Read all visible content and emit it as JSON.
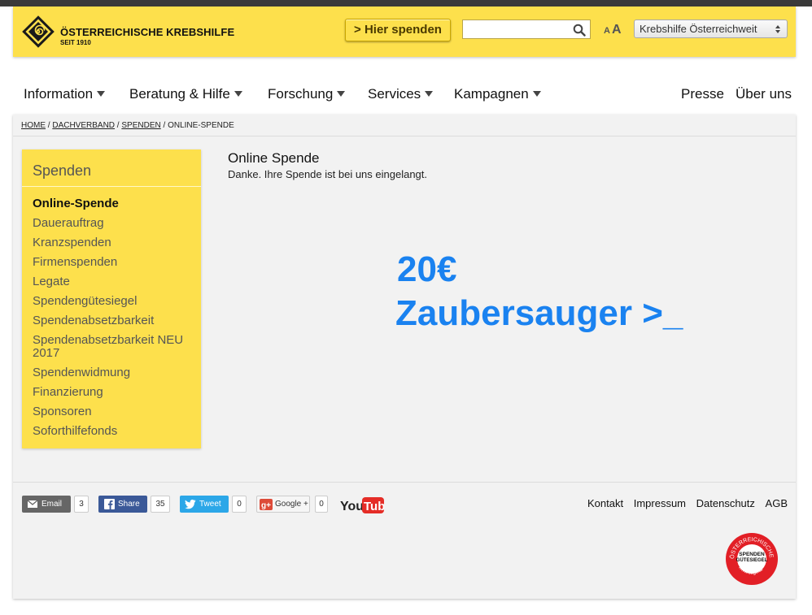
{
  "header": {
    "logo_name": "ÖSTERREICHISCHE KREBSHILFE",
    "logo_since": "SEIT 1910",
    "donate_label": "> Hier spenden",
    "search_value": "",
    "font_small": "A",
    "font_large": "A",
    "region_selected": "Krebshilfe Österreichweit"
  },
  "nav": {
    "items": [
      "Information",
      "Beratung & Hilfe",
      "Forschung",
      "Services",
      "Kampagnen"
    ],
    "right": [
      "Presse",
      "Über uns"
    ]
  },
  "breadcrumb": [
    "HOME",
    "DACHVERBAND",
    "SPENDEN",
    "ONLINE-SPENDE"
  ],
  "sidebar": {
    "title": "Spenden",
    "items": [
      "Online-Spende",
      "Dauerauftrag",
      "Kranzspenden",
      "Firmenspenden",
      "Legate",
      "Spendengütesiegel",
      "Spendenabsetzbarkeit",
      "Spendenabsetzbarkeit NEU 2017",
      "Spendenwidmung",
      "Finanzierung",
      "Sponsoren",
      "Soforthilfefonds"
    ]
  },
  "content": {
    "title": "Online Spende",
    "message": "Danke. Ihre Spende ist bei uns eingelangt.",
    "overlay_line1": "20€",
    "overlay_line2": "Zaubersauger >_"
  },
  "share": {
    "email": {
      "label": "Email",
      "count": "3"
    },
    "facebook": {
      "label": "Share",
      "count": "35"
    },
    "twitter": {
      "label": "Tweet",
      "count": "0"
    },
    "google": {
      "label": "Google +",
      "count": "0"
    },
    "youtube": "YouTube"
  },
  "footer": {
    "links": [
      "Kontakt",
      "Impressum",
      "Datenschutz",
      "AGB"
    ],
    "seal": {
      "top": "ÖSTERREICHISCHES",
      "line1": "SPENDEN",
      "line2": "GÜTESIEGEL",
      "number": "05139",
      "url": "www.osgs.at"
    }
  },
  "colors": {
    "brand_yellow": "#fde04c",
    "overlay_blue": "#1a82f0",
    "facebook": "#3b5998",
    "twitter": "#2ca7e8",
    "email": "#666666"
  }
}
